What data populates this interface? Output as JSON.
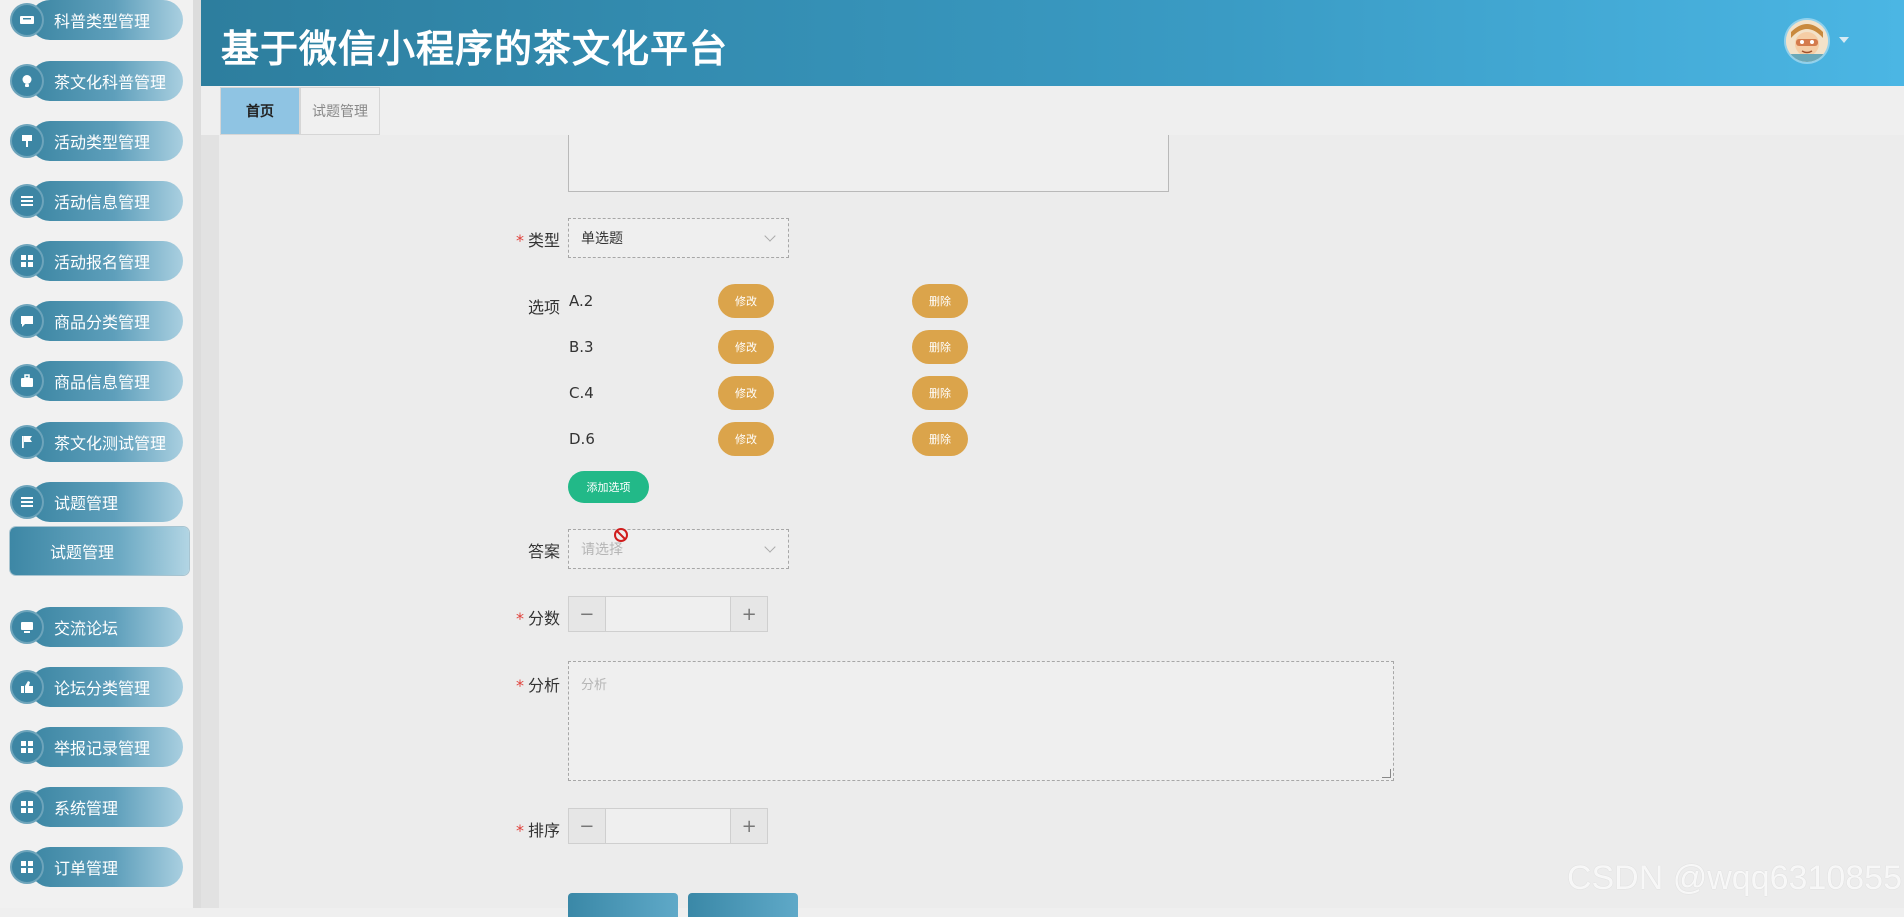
{
  "app": {
    "title": "基于微信小程序的茶文化平台"
  },
  "sidebar": {
    "items": [
      {
        "label": "科普类型管理",
        "icon": "ticket-icon"
      },
      {
        "label": "茶文化科普管理",
        "icon": "bulb-icon"
      },
      {
        "label": "活动类型管理",
        "icon": "sign-icon"
      },
      {
        "label": "活动信息管理",
        "icon": "list-icon"
      },
      {
        "label": "活动报名管理",
        "icon": "grid-icon"
      },
      {
        "label": "商品分类管理",
        "icon": "chat-icon"
      },
      {
        "label": "商品信息管理",
        "icon": "briefcase-icon"
      },
      {
        "label": "茶文化测试管理",
        "icon": "flag-icon"
      },
      {
        "label": "试题管理",
        "icon": "list-icon"
      },
      {
        "label": "交流论坛",
        "icon": "monitor-icon"
      },
      {
        "label": "论坛分类管理",
        "icon": "thumb-icon"
      },
      {
        "label": "举报记录管理",
        "icon": "grid-icon"
      },
      {
        "label": "系统管理",
        "icon": "grid-icon"
      },
      {
        "label": "订单管理",
        "icon": "grid-icon"
      }
    ],
    "active_sub": {
      "label": "试题管理"
    }
  },
  "tabs": [
    {
      "label": "首页",
      "active": true
    },
    {
      "label": "试题管理",
      "active": false
    }
  ],
  "form": {
    "type": {
      "label": "类型",
      "value": "单选题",
      "required": true
    },
    "options": {
      "label": "选项",
      "items": [
        {
          "text": "A.2",
          "edit_label": "修改",
          "delete_label": "删除"
        },
        {
          "text": "B.3",
          "edit_label": "修改",
          "delete_label": "删除"
        },
        {
          "text": "C.4",
          "edit_label": "修改",
          "delete_label": "删除"
        },
        {
          "text": "D.6",
          "edit_label": "修改",
          "delete_label": "删除"
        }
      ],
      "add_label": "添加选项"
    },
    "answer": {
      "label": "答案",
      "placeholder": "请选择",
      "required": false
    },
    "score": {
      "label": "分数",
      "required": true,
      "minus": "−",
      "plus": "+"
    },
    "analysis": {
      "label": "分析",
      "placeholder": "分析",
      "required": true
    },
    "order": {
      "label": "排序",
      "required": true,
      "minus": "−",
      "plus": "+"
    },
    "required_mark": "*"
  },
  "watermark": "CSDN @wqq6310855",
  "colors": {
    "header": "#2d7e9e",
    "accent_orange": "#dba44b",
    "accent_green": "#22b988",
    "required": "#e0403a"
  }
}
